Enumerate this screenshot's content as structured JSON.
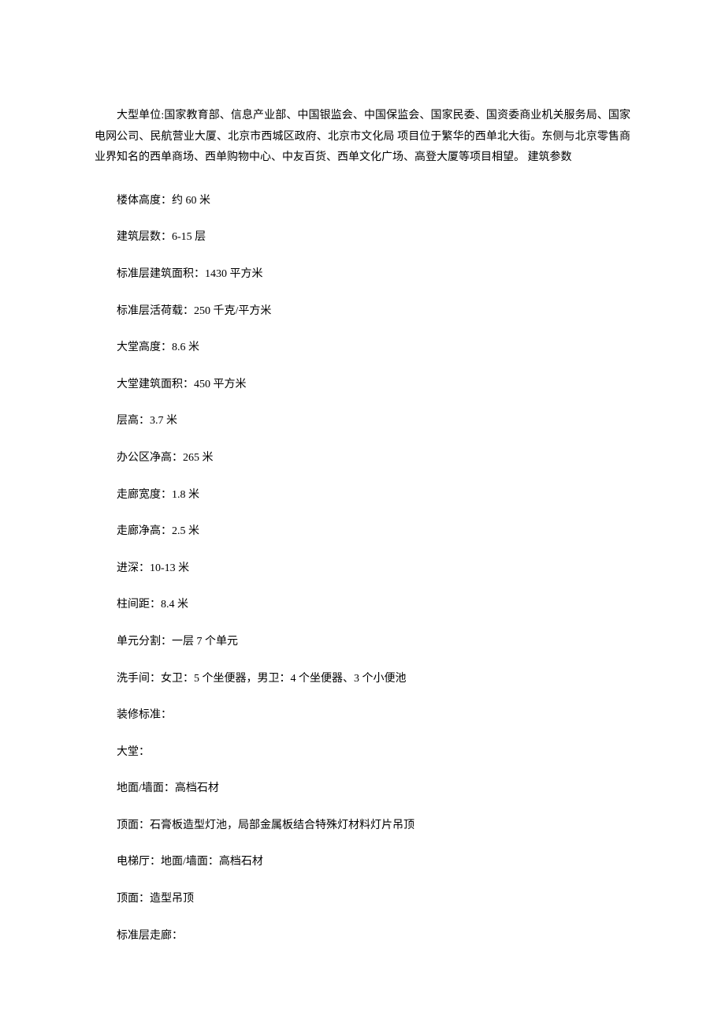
{
  "intro": "大型单位:国家教育部、信息产业部、中国银监会、中国保监会、国家民委、国资委商业机关服务局、国家电网公司、民航营业大厦、北京市西城区政府、北京市文化局 项目位于繁华的西单北大街。东侧与北京零售商业界知名的西单商场、西单购物中心、中友百货、西单文化广场、高登大厦等项目相望。 建筑参数",
  "params": {
    "p0": "楼体高度：约 60 米",
    "p1": "建筑层数：6-15 层",
    "p2": "标准层建筑面积：1430 平方米",
    "p3": "标准层活荷载：250 千克/平方米",
    "p4": "大堂高度：8.6 米",
    "p5": "大堂建筑面积：450 平方米",
    "p6": "层高：3.7 米",
    "p7": "办公区净高：265 米",
    "p8": "走廊宽度：1.8 米",
    "p9": "走廊净高：2.5 米",
    "p10": "进深：10-13 米",
    "p11": "柱间距：8.4 米",
    "p12": "单元分割：一层 7 个单元",
    "p13": "洗手间：女卫：5 个坐便器，男卫：4 个坐便器、3 个小便池",
    "p14": "装修标准：",
    "p15": "大堂：",
    "p16": "地面/墙面：高档石材",
    "p17": "顶面：石膏板造型灯池，局部金属板结合特殊灯材料灯片吊顶",
    "p18": "电梯厅：地面/墙面：高档石材",
    "p19": "顶面：造型吊顶",
    "p20": "标准层走廊："
  }
}
